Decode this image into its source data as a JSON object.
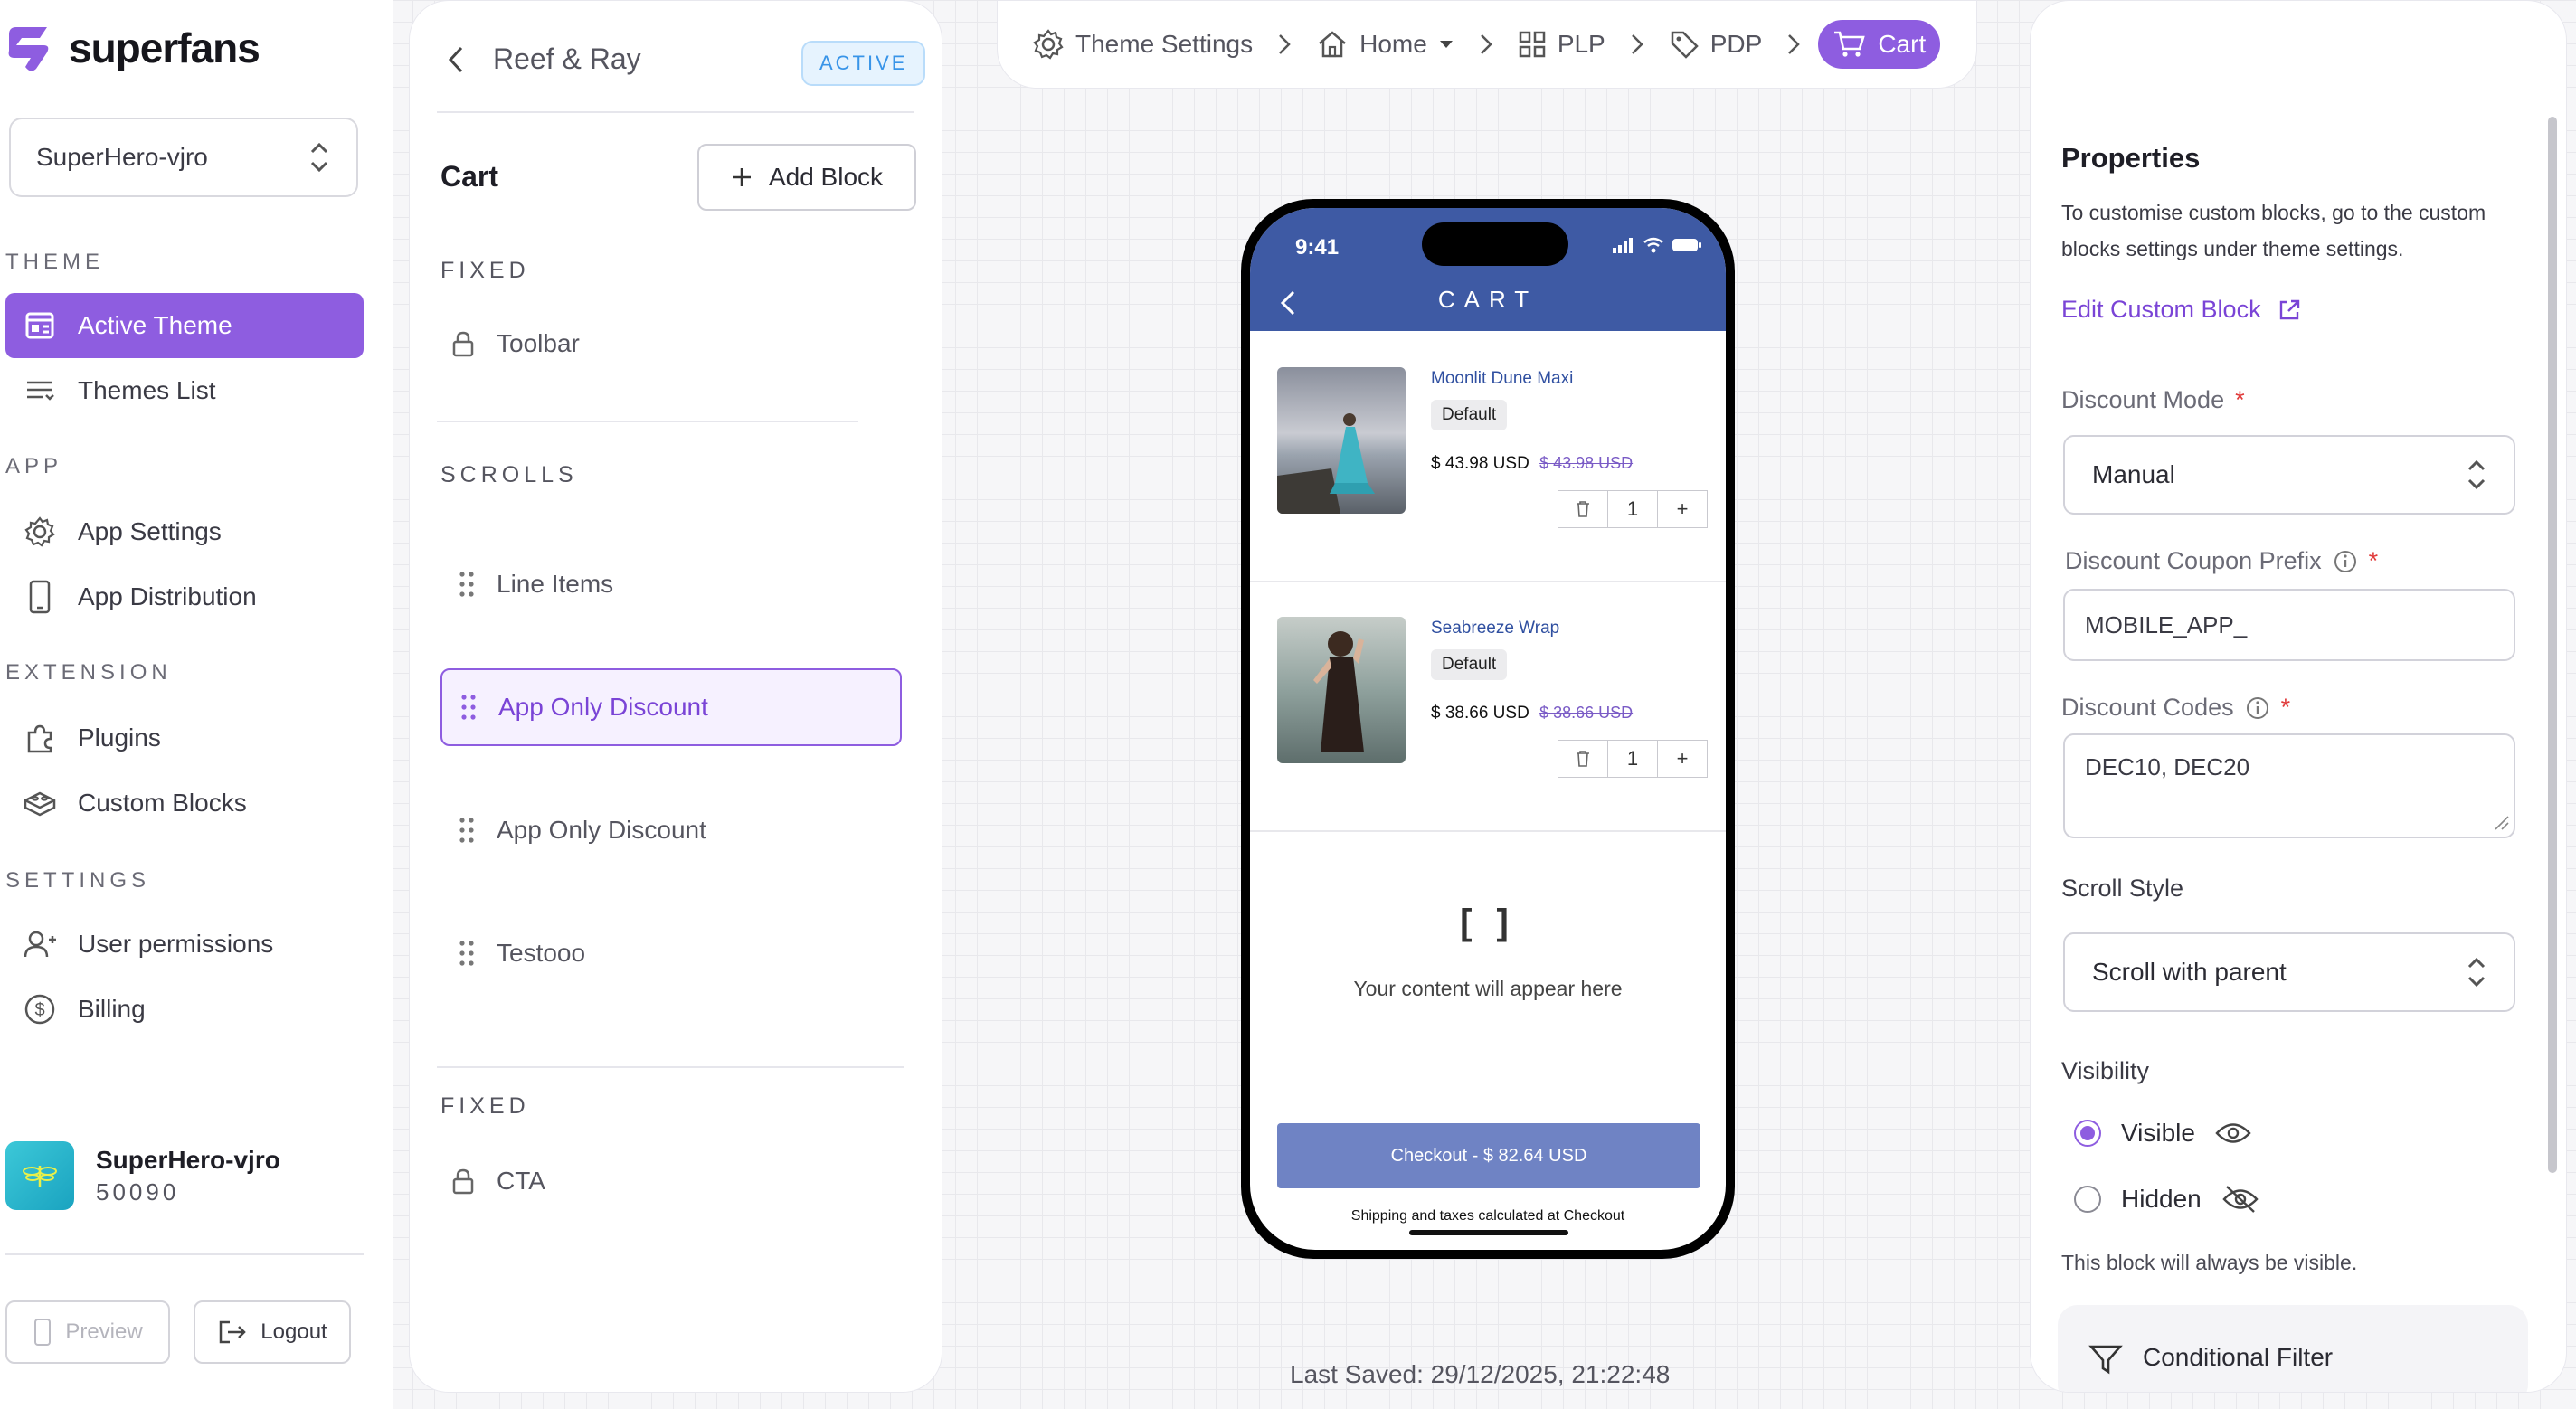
{
  "sidebar": {
    "brand": "superfans",
    "store_select": "SuperHero-vjro",
    "sections": {
      "theme": "THEME",
      "app": "APP",
      "extension": "EXTENSION",
      "settings": "SETTINGS"
    },
    "items": {
      "active_theme": "Active Theme",
      "themes_list": "Themes List",
      "app_settings": "App Settings",
      "app_distribution": "App Distribution",
      "plugins": "Plugins",
      "custom_blocks": "Custom Blocks",
      "user_permissions": "User permissions",
      "billing": "Billing"
    },
    "profile": {
      "name": "SuperHero-vjro",
      "id": "50090"
    },
    "preview_label": "Preview",
    "logout_label": "Logout",
    "accent": "#8e5de0"
  },
  "blocks_panel": {
    "theme_name": "Reef & Ray",
    "status": "ACTIVE",
    "page": "Cart",
    "add_block": "Add Block",
    "fixed_top": "FIXED",
    "toolbar": "Toolbar",
    "scrolls": "SCROLLS",
    "rows": [
      "Line Items",
      "App Only Discount",
      "App Only Discount",
      "Testooo"
    ],
    "fixed_bottom": "FIXED",
    "cta": "CTA"
  },
  "breadcrumb": {
    "items": [
      "Theme Settings",
      "Home",
      "PLP",
      "PDP",
      "Cart"
    ]
  },
  "preview": {
    "time": "9:41",
    "header": "CART",
    "items": [
      {
        "name": "Moonlit Dune Maxi",
        "variant": "Default",
        "price": "$ 43.98 USD",
        "compare": "$ 43.98 USD",
        "qty": "1"
      },
      {
        "name": "Seabreeze Wrap",
        "variant": "Default",
        "price": "$ 38.66 USD",
        "compare": "$ 38.66 USD",
        "qty": "1"
      }
    ],
    "placeholder_icon": "[ ]",
    "placeholder_text": "Your content will appear here",
    "checkout": "Checkout  -  $ 82.64 USD",
    "shipping_note": "Shipping and taxes calculated at Checkout",
    "header_color": "#3e5aa4"
  },
  "last_saved": "Last Saved:   29/12/2025, 21:22:48",
  "properties": {
    "title": "Properties",
    "description": "To customise custom blocks, go to the custom blocks settings under theme settings.",
    "edit_link": "Edit Custom Block",
    "discount_mode_label": "Discount Mode",
    "discount_mode_value": "Manual",
    "coupon_prefix_label": "Discount Coupon Prefix",
    "coupon_prefix_value": "MOBILE_APP_",
    "codes_label": "Discount Codes",
    "codes_value": "DEC10, DEC20",
    "scroll_style_label": "Scroll Style",
    "scroll_style_value": "Scroll with parent",
    "visibility_label": "Visibility",
    "visible_option": "Visible",
    "hidden_option": "Hidden",
    "visibility_note": "This block will always be visible.",
    "conditional_filter": "Conditional Filter",
    "required_mark": "*"
  }
}
